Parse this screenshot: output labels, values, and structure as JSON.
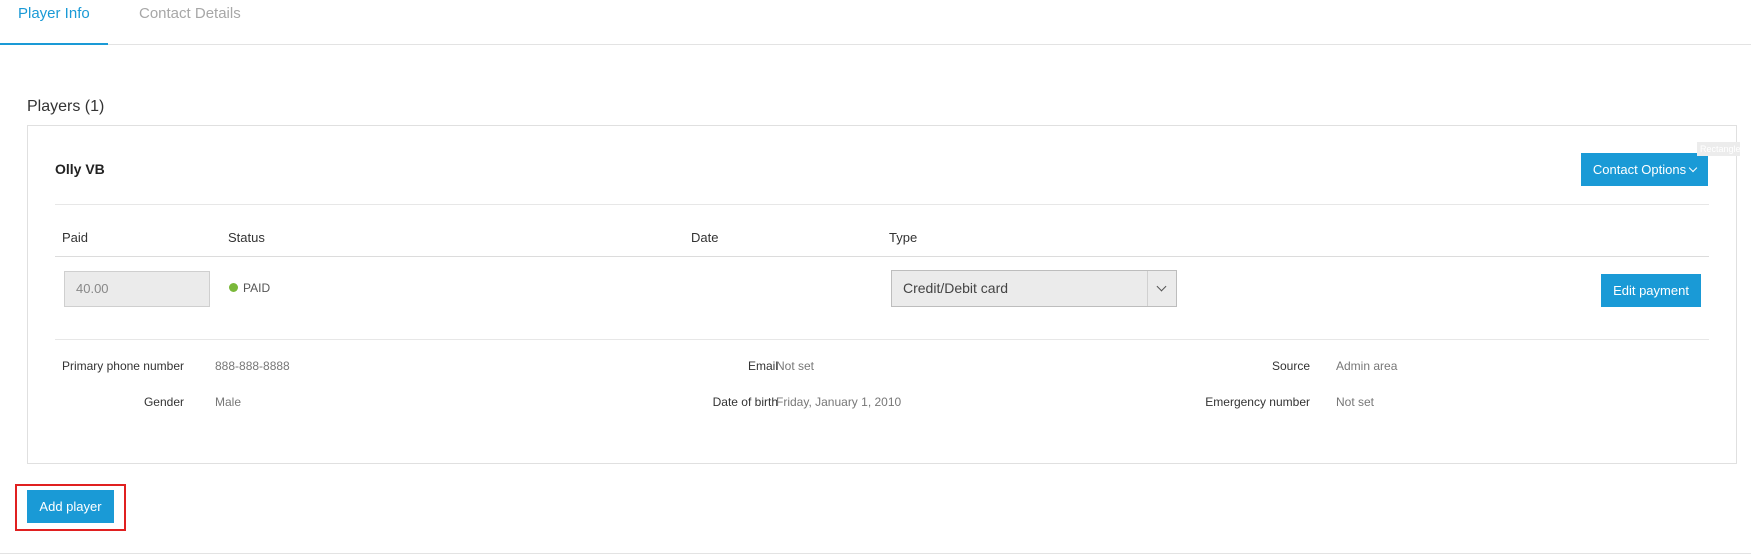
{
  "tabs": [
    {
      "label": "Player Info",
      "active": true
    },
    {
      "label": "Contact Details",
      "active": false
    }
  ],
  "players_section": {
    "title": "Players (1)"
  },
  "player": {
    "name": "Olly VB",
    "contact_options_label": "Contact Options",
    "payment": {
      "headers": {
        "paid": "Paid",
        "status": "Status",
        "date": "Date",
        "type": "Type"
      },
      "paid_value": "40.00",
      "status": "PAID",
      "date": "",
      "type_selected": "Credit/Debit card",
      "edit_label": "Edit payment"
    },
    "details": {
      "primary_phone_label": "Primary phone number",
      "primary_phone_value": "888-888-8888",
      "email_label": "Email",
      "email_value": "Not set",
      "source_label": "Source",
      "source_value": "Admin area",
      "gender_label": "Gender",
      "gender_value": "Male",
      "dob_label": "Date of birth",
      "dob_value": "Friday, January 1, 2010",
      "emergency_label": "Emergency number",
      "emergency_value": "Not set"
    }
  },
  "add_player_label": "Add player",
  "overlay_label": "Rectangle",
  "colors": {
    "accent": "#1a9ad6",
    "paid_status": "#7ab83a",
    "highlight": "#e02020"
  }
}
